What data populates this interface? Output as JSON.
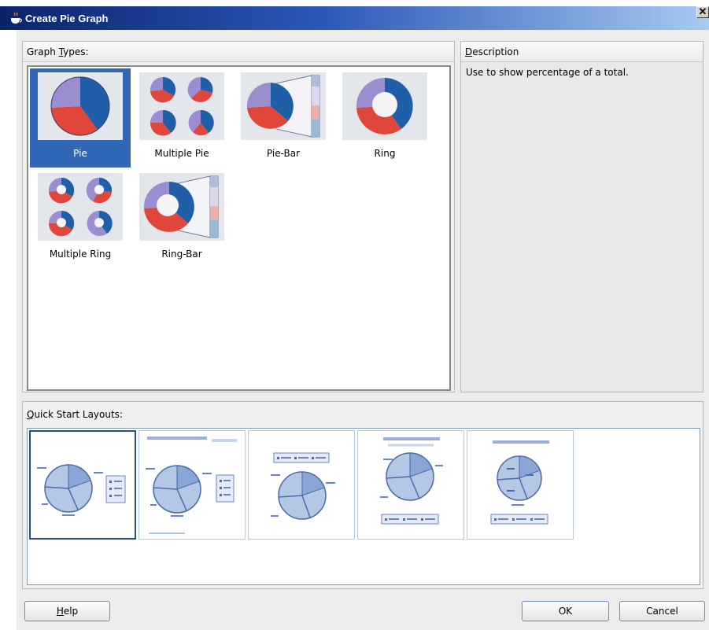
{
  "window": {
    "title": "Create Pie Graph",
    "close_glyph": "✕"
  },
  "graph_types": {
    "header_prefix": "Graph ",
    "header_mnemonic": "T",
    "header_suffix": "ypes:",
    "items": [
      {
        "label": "Pie",
        "icon": "pie-graph-icon",
        "selected": true
      },
      {
        "label": "Multiple Pie",
        "icon": "multiple-pie-graph-icon",
        "selected": false
      },
      {
        "label": "Pie-Bar",
        "icon": "pie-bar-graph-icon",
        "selected": false
      },
      {
        "label": "Ring",
        "icon": "ring-graph-icon",
        "selected": false
      },
      {
        "label": "Multiple Ring",
        "icon": "multiple-ring-graph-icon",
        "selected": false
      },
      {
        "label": "Ring-Bar",
        "icon": "ring-bar-graph-icon",
        "selected": false
      }
    ]
  },
  "description": {
    "header_mnemonic": "D",
    "header_suffix": "escription",
    "text": "Use to show percentage of a total."
  },
  "quick_start": {
    "header_mnemonic": "Q",
    "header_suffix": "uick Start Layouts:",
    "layouts": [
      {
        "icon": "layout-pie-legend-right-icon",
        "selected": true
      },
      {
        "icon": "layout-title-pie-legend-right-icon",
        "selected": false
      },
      {
        "icon": "layout-legend-top-pie-icon",
        "selected": false
      },
      {
        "icon": "layout-title-pie-legend-bottom-icon",
        "selected": false
      },
      {
        "icon": "layout-title-pie-labels-legend-bottom-icon",
        "selected": false
      }
    ]
  },
  "buttons": {
    "help_mnemonic": "H",
    "help_suffix": "elp",
    "ok": "OK",
    "cancel": "Cancel"
  },
  "colors": {
    "title_gradient_start": "#0a246a",
    "selection": "#3167b7",
    "pie_blue": "#1f5fa8",
    "pie_red": "#e0463a",
    "pie_lavender": "#9a8ed0"
  }
}
